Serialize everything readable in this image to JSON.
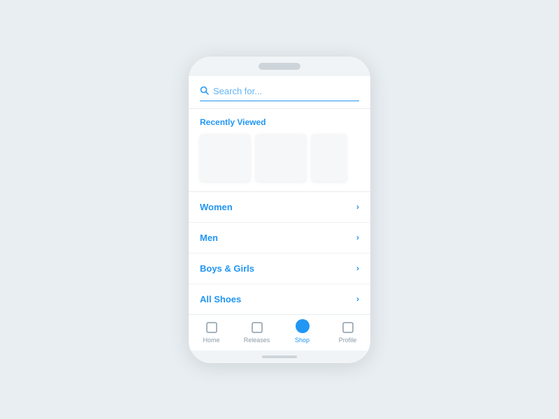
{
  "search": {
    "placeholder": "Search for..."
  },
  "recently_viewed": {
    "title": "Recently Viewed"
  },
  "categories": [
    {
      "id": "women",
      "label": "Women"
    },
    {
      "id": "men",
      "label": "Men"
    },
    {
      "id": "boys-girls",
      "label": "Boys & Girls"
    },
    {
      "id": "all-shoes",
      "label": "All Shoes"
    }
  ],
  "nav": {
    "items": [
      {
        "id": "home",
        "label": "Home",
        "active": false
      },
      {
        "id": "releases",
        "label": "Releases",
        "active": false
      },
      {
        "id": "shop",
        "label": "Shop",
        "active": true
      },
      {
        "id": "profile",
        "label": "Profile",
        "active": false
      }
    ]
  },
  "colors": {
    "accent": "#2196f3",
    "bg": "#e8eef2"
  }
}
